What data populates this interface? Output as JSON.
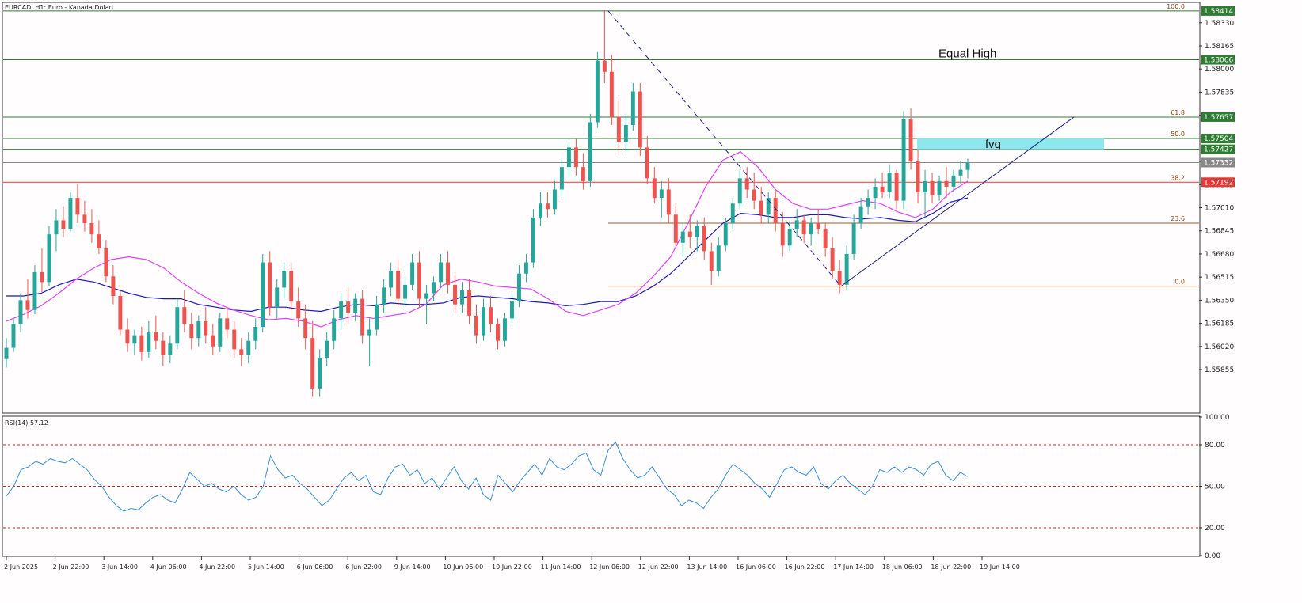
{
  "header": {
    "title": "EURCAD, H1:  Euro - Kanada Dolari"
  },
  "colors": {
    "bull": "#26a69a",
    "bear": "#ef5350",
    "ma_fast": "#e040fb",
    "ma_slow": "#1a1ab8",
    "level_green": "#2e7d32",
    "level_red": "#e53935",
    "level_gray": "#888888",
    "fvg": "#8ee6ee",
    "rsi": "#3b8fd9",
    "rsi_level": "#c62828"
  },
  "chart_data": [
    {
      "type": "candlestick",
      "title": "EURCAD, H1:  Euro - Kanada Dolari",
      "ylim": [
        1.5555,
        1.5847
      ],
      "y_ticks": [
        "1.58330",
        "1.58165",
        "1.58000",
        "1.57835",
        "1.57670",
        "1.57505",
        "1.57340",
        "1.57175",
        "1.57010",
        "1.56845",
        "1.56680",
        "1.56515",
        "1.56350",
        "1.56185",
        "1.56020",
        "1.55855"
      ],
      "x_ticks": [
        "2 Jun 2025",
        "2 Jun 22:00",
        "3 Jun 14:00",
        "4 Jun 06:00",
        "4 Jun 22:00",
        "5 Jun 14:00",
        "6 Jun 06:00",
        "6 Jun 22:00",
        "9 Jun 14:00",
        "10 Jun 06:00",
        "10 Jun 22:00",
        "11 Jun 14:00",
        "12 Jun 06:00",
        "12 Jun 22:00",
        "13 Jun 14:00",
        "16 Jun 06:00",
        "16 Jun 22:00",
        "17 Jun 14:00",
        "18 Jun 06:00",
        "18 Jun 22:00",
        "19 Jun 14:00"
      ],
      "ohlc": [
        [
          1.5593,
          1.5608,
          1.5587,
          1.5601
        ],
        [
          1.5601,
          1.5622,
          1.5598,
          1.5618
        ],
        [
          1.5618,
          1.564,
          1.5612,
          1.5635
        ],
        [
          1.5635,
          1.565,
          1.5622,
          1.5628
        ],
        [
          1.5628,
          1.566,
          1.5625,
          1.5655
        ],
        [
          1.5655,
          1.5672,
          1.564,
          1.5648
        ],
        [
          1.5648,
          1.5688,
          1.5645,
          1.5682
        ],
        [
          1.5682,
          1.57,
          1.567,
          1.5692
        ],
        [
          1.5692,
          1.5702,
          1.568,
          1.5686
        ],
        [
          1.5686,
          1.5712,
          1.5684,
          1.5708
        ],
        [
          1.5708,
          1.5718,
          1.569,
          1.5696
        ],
        [
          1.5696,
          1.5706,
          1.5684,
          1.569
        ],
        [
          1.569,
          1.57,
          1.5676,
          1.5682
        ],
        [
          1.5682,
          1.5692,
          1.5668,
          1.5672
        ],
        [
          1.5672,
          1.5678,
          1.5648,
          1.5652
        ],
        [
          1.5652,
          1.566,
          1.5632,
          1.5638
        ],
        [
          1.5638,
          1.5642,
          1.561,
          1.5614
        ],
        [
          1.5614,
          1.5622,
          1.5598,
          1.5604
        ],
        [
          1.5604,
          1.5614,
          1.5596,
          1.561
        ],
        [
          1.561,
          1.5616,
          1.5592,
          1.5598
        ],
        [
          1.5598,
          1.562,
          1.5594,
          1.5612
        ],
        [
          1.5612,
          1.5624,
          1.56,
          1.5606
        ],
        [
          1.5606,
          1.5612,
          1.5588,
          1.5596
        ],
        [
          1.5596,
          1.561,
          1.559,
          1.5604
        ],
        [
          1.5604,
          1.5636,
          1.56,
          1.563
        ],
        [
          1.563,
          1.5642,
          1.5612,
          1.5618
        ],
        [
          1.5618,
          1.5626,
          1.56,
          1.5608
        ],
        [
          1.5608,
          1.5624,
          1.5602,
          1.562
        ],
        [
          1.562,
          1.563,
          1.5604,
          1.561
        ],
        [
          1.561,
          1.5618,
          1.5596,
          1.5602
        ],
        [
          1.5602,
          1.5626,
          1.5598,
          1.5622
        ],
        [
          1.5622,
          1.563,
          1.5608,
          1.5614
        ],
        [
          1.5614,
          1.562,
          1.5594,
          1.56
        ],
        [
          1.56,
          1.5608,
          1.5588,
          1.5596
        ],
        [
          1.5596,
          1.5612,
          1.559,
          1.5606
        ],
        [
          1.5606,
          1.5622,
          1.56,
          1.5616
        ],
        [
          1.5616,
          1.5668,
          1.5612,
          1.5662
        ],
        [
          1.5662,
          1.567,
          1.5624,
          1.563
        ],
        [
          1.563,
          1.565,
          1.5622,
          1.5644
        ],
        [
          1.5644,
          1.5662,
          1.5636,
          1.5656
        ],
        [
          1.5656,
          1.5662,
          1.5628,
          1.5634
        ],
        [
          1.5634,
          1.5644,
          1.5616,
          1.5622
        ],
        [
          1.5622,
          1.5632,
          1.56,
          1.5608
        ],
        [
          1.5608,
          1.562,
          1.5566,
          1.5572
        ],
        [
          1.5572,
          1.56,
          1.5566,
          1.5594
        ],
        [
          1.5594,
          1.5612,
          1.5588,
          1.5606
        ],
        [
          1.5606,
          1.5628,
          1.56,
          1.5622
        ],
        [
          1.5622,
          1.564,
          1.5614,
          1.5634
        ],
        [
          1.5634,
          1.5644,
          1.5618,
          1.5626
        ],
        [
          1.5626,
          1.564,
          1.562,
          1.5636
        ],
        [
          1.5636,
          1.5642,
          1.5604,
          1.561
        ],
        [
          1.561,
          1.5622,
          1.5588,
          1.5614
        ],
        [
          1.5614,
          1.5638,
          1.561,
          1.5632
        ],
        [
          1.5632,
          1.565,
          1.5626,
          1.5644
        ],
        [
          1.5644,
          1.5662,
          1.5638,
          1.5656
        ],
        [
          1.5656,
          1.5664,
          1.563,
          1.5636
        ],
        [
          1.5636,
          1.5652,
          1.563,
          1.5646
        ],
        [
          1.5646,
          1.5668,
          1.5642,
          1.5662
        ],
        [
          1.5662,
          1.567,
          1.563,
          1.5636
        ],
        [
          1.5636,
          1.5646,
          1.5618,
          1.564
        ],
        [
          1.564,
          1.5652,
          1.5634,
          1.5648
        ],
        [
          1.5648,
          1.5668,
          1.5644,
          1.5662
        ],
        [
          1.5662,
          1.567,
          1.564,
          1.5646
        ],
        [
          1.5646,
          1.5654,
          1.5626,
          1.5632
        ],
        [
          1.5632,
          1.5648,
          1.5626,
          1.5642
        ],
        [
          1.5642,
          1.565,
          1.5618,
          1.5624
        ],
        [
          1.5624,
          1.5632,
          1.5604,
          1.561
        ],
        [
          1.561,
          1.5636,
          1.5606,
          1.563
        ],
        [
          1.563,
          1.5638,
          1.5612,
          1.5618
        ],
        [
          1.5618,
          1.5622,
          1.56,
          1.5606
        ],
        [
          1.5606,
          1.5626,
          1.5602,
          1.5622
        ],
        [
          1.5622,
          1.564,
          1.5618,
          1.5634
        ],
        [
          1.5634,
          1.566,
          1.563,
          1.5654
        ],
        [
          1.5654,
          1.5668,
          1.5648,
          1.5662
        ],
        [
          1.5662,
          1.57,
          1.5658,
          1.5694
        ],
        [
          1.5694,
          1.5712,
          1.5688,
          1.5704
        ],
        [
          1.5704,
          1.5712,
          1.5694,
          1.57
        ],
        [
          1.57,
          1.572,
          1.5696,
          1.5714
        ],
        [
          1.5714,
          1.5736,
          1.5708,
          1.573
        ],
        [
          1.573,
          1.5748,
          1.5722,
          1.5744
        ],
        [
          1.5744,
          1.575,
          1.5724,
          1.573
        ],
        [
          1.573,
          1.574,
          1.5714,
          1.572
        ],
        [
          1.572,
          1.5768,
          1.5716,
          1.5762
        ],
        [
          1.5762,
          1.5812,
          1.5758,
          1.5806
        ],
        [
          1.5806,
          1.5842,
          1.579,
          1.5798
        ],
        [
          1.5798,
          1.581,
          1.576,
          1.5766
        ],
        [
          1.5766,
          1.5778,
          1.574,
          1.5748
        ],
        [
          1.5748,
          1.5768,
          1.574,
          1.576
        ],
        [
          1.576,
          1.579,
          1.5756,
          1.5784
        ],
        [
          1.5784,
          1.579,
          1.5738,
          1.5744
        ],
        [
          1.5744,
          1.5752,
          1.5718,
          1.5722
        ],
        [
          1.5722,
          1.573,
          1.5704,
          1.5708
        ],
        [
          1.5708,
          1.572,
          1.5694,
          1.5714
        ],
        [
          1.5714,
          1.5722,
          1.569,
          1.5696
        ],
        [
          1.5696,
          1.5704,
          1.5672,
          1.5676
        ],
        [
          1.5676,
          1.569,
          1.5666,
          1.5684
        ],
        [
          1.5684,
          1.5696,
          1.5672,
          1.568
        ],
        [
          1.568,
          1.5692,
          1.567,
          1.5688
        ],
        [
          1.5688,
          1.5694,
          1.5664,
          1.567
        ],
        [
          1.567,
          1.5676,
          1.5646,
          1.5656
        ],
        [
          1.5656,
          1.568,
          1.5652,
          1.5674
        ],
        [
          1.5674,
          1.5694,
          1.567,
          1.569
        ],
        [
          1.569,
          1.5708,
          1.5686,
          1.5704
        ],
        [
          1.5704,
          1.5728,
          1.57,
          1.5722
        ],
        [
          1.5722,
          1.573,
          1.5708,
          1.5714
        ],
        [
          1.5714,
          1.5726,
          1.57,
          1.5706
        ],
        [
          1.5706,
          1.5716,
          1.569,
          1.5696
        ],
        [
          1.5696,
          1.5712,
          1.569,
          1.5708
        ],
        [
          1.5708,
          1.5714,
          1.5684,
          1.569
        ],
        [
          1.569,
          1.5698,
          1.5666,
          1.5674
        ],
        [
          1.5674,
          1.5692,
          1.567,
          1.5686
        ],
        [
          1.5686,
          1.57,
          1.568,
          1.5692
        ],
        [
          1.5692,
          1.5696,
          1.5676,
          1.5682
        ],
        [
          1.5682,
          1.5694,
          1.5674,
          1.569
        ],
        [
          1.569,
          1.57,
          1.5682,
          1.5686
        ],
        [
          1.5686,
          1.569,
          1.5666,
          1.5672
        ],
        [
          1.5672,
          1.568,
          1.565,
          1.5656
        ],
        [
          1.5656,
          1.5664,
          1.564,
          1.5646
        ],
        [
          1.5646,
          1.5674,
          1.5642,
          1.5668
        ],
        [
          1.5668,
          1.5696,
          1.5664,
          1.569
        ],
        [
          1.569,
          1.5708,
          1.5686,
          1.5702
        ],
        [
          1.5702,
          1.5714,
          1.5696,
          1.5708
        ],
        [
          1.5708,
          1.5722,
          1.57,
          1.5716
        ],
        [
          1.5716,
          1.5726,
          1.5708,
          1.5712
        ],
        [
          1.5712,
          1.5732,
          1.5708,
          1.5726
        ],
        [
          1.5726,
          1.5728,
          1.57,
          1.5706
        ],
        [
          1.5706,
          1.577,
          1.57,
          1.5764
        ],
        [
          1.5764,
          1.5772,
          1.5728,
          1.5734
        ],
        [
          1.5734,
          1.5742,
          1.5704,
          1.5712
        ],
        [
          1.5712,
          1.5728,
          1.5694,
          1.572
        ],
        [
          1.572,
          1.5726,
          1.5704,
          1.571
        ],
        [
          1.571,
          1.5724,
          1.5706,
          1.572
        ],
        [
          1.572,
          1.573,
          1.5708,
          1.5716
        ],
        [
          1.5716,
          1.5728,
          1.5712,
          1.5724
        ],
        [
          1.5724,
          1.5734,
          1.5718,
          1.5728
        ],
        [
          1.5728,
          1.5736,
          1.5722,
          1.5733
        ]
      ],
      "ma_fast": [
        1.562,
        1.5625,
        1.5631,
        1.564,
        1.565,
        1.5658,
        1.5664,
        1.5666,
        1.5664,
        1.5658,
        1.5648,
        1.564,
        1.5633,
        1.5628,
        1.5624,
        1.5621,
        1.5622,
        1.562,
        1.5616,
        1.5621,
        1.5624,
        1.5622,
        1.5624,
        1.5626,
        1.5632,
        1.5646,
        1.565,
        1.5648,
        1.5645,
        1.5644,
        1.5643,
        1.5636,
        1.5627,
        1.5624,
        1.5628,
        1.5632,
        1.564,
        1.5652,
        1.5666,
        1.569,
        1.5716,
        1.5735,
        1.5741,
        1.573,
        1.5714,
        1.5704,
        1.57,
        1.57,
        1.5703,
        1.5706,
        1.5704,
        1.5698,
        1.5694,
        1.57,
        1.5712,
        1.572
      ],
      "ma_slow": [
        1.5638,
        1.5638,
        1.564,
        1.5646,
        1.565,
        1.5648,
        1.5644,
        1.564,
        1.5637,
        1.5636,
        1.5636,
        1.5632,
        1.563,
        1.5628,
        1.5627,
        1.563,
        1.563,
        1.5628,
        1.5627,
        1.563,
        1.5632,
        1.5631,
        1.5633,
        1.5632,
        1.5632,
        1.5633,
        1.5637,
        1.5638,
        1.5637,
        1.5636,
        1.5634,
        1.5633,
        1.5631,
        1.5632,
        1.5634,
        1.5634,
        1.5638,
        1.5645,
        1.5654,
        1.5666,
        1.5678,
        1.569,
        1.5697,
        1.5696,
        1.5694,
        1.5694,
        1.5696,
        1.5696,
        1.5694,
        1.5693,
        1.5694,
        1.5692,
        1.5691,
        1.5697,
        1.5705,
        1.5708
      ],
      "levels": [
        {
          "price": 1.58414,
          "label": "1.58414",
          "fib": "100.0",
          "color": "green"
        },
        {
          "price": 1.58066,
          "label": "1.58066",
          "fib": "",
          "color": "green"
        },
        {
          "price": 1.57657,
          "label": "1.57657",
          "fib": "61.8",
          "color": "green"
        },
        {
          "price": 1.57504,
          "label": "1.57504",
          "fib": "50.0",
          "color": "green"
        },
        {
          "price": 1.57427,
          "label": "1.57427",
          "fib": "",
          "color": "green"
        },
        {
          "price": 1.57332,
          "label": "1.57332",
          "fib": "",
          "color": "gray"
        },
        {
          "price": 1.57192,
          "label": "1.57192",
          "fib": "38.2",
          "color": "red"
        }
      ],
      "fib_partial": [
        {
          "price": 1.569,
          "fib": "23.6"
        },
        {
          "price": 1.5645,
          "fib": "0.0"
        }
      ],
      "annotations": {
        "equal_high": "Equal High",
        "fvg": "fvg"
      }
    },
    {
      "type": "line",
      "title": "RSI(14) 57.12",
      "ylim": [
        0,
        100
      ],
      "y_ticks": [
        "100.00",
        "80.00",
        "50.00",
        "20.00",
        "0.00"
      ],
      "levels": [
        80,
        50,
        20
      ],
      "values": [
        43,
        50,
        62,
        64,
        68,
        66,
        70,
        68,
        67,
        70,
        66,
        62,
        55,
        50,
        42,
        36,
        32,
        34,
        33,
        38,
        42,
        44,
        40,
        38,
        48,
        60,
        55,
        50,
        52,
        48,
        46,
        50,
        44,
        40,
        42,
        50,
        72,
        62,
        56,
        58,
        52,
        48,
        42,
        36,
        40,
        48,
        56,
        60,
        54,
        58,
        46,
        44,
        56,
        64,
        66,
        58,
        62,
        52,
        56,
        48,
        56,
        64,
        54,
        48,
        56,
        44,
        40,
        58,
        52,
        46,
        54,
        60,
        66,
        58,
        70,
        64,
        62,
        66,
        72,
        74,
        62,
        58,
        76,
        82,
        70,
        62,
        56,
        58,
        64,
        56,
        48,
        44,
        36,
        40,
        38,
        34,
        42,
        48,
        58,
        66,
        62,
        58,
        52,
        48,
        42,
        52,
        62,
        64,
        60,
        58,
        64,
        52,
        48,
        54,
        58,
        52,
        48,
        44,
        50,
        62,
        60,
        64,
        60,
        64,
        62,
        58,
        66,
        68,
        58,
        54,
        60,
        57
      ]
    }
  ],
  "price_label_current": "1.57332",
  "rsi_title": "RSI(14) 57.12"
}
